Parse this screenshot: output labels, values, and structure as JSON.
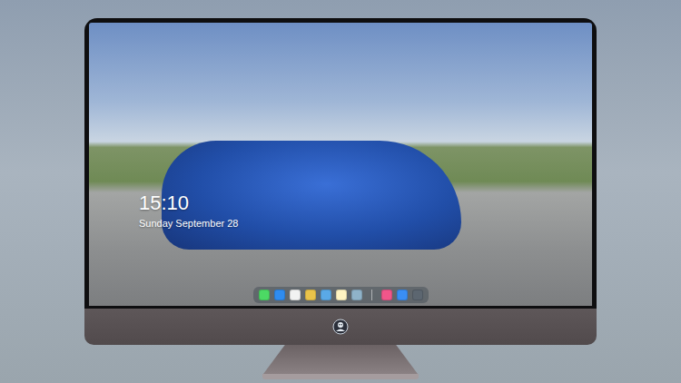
{
  "clock": {
    "time": "15:10",
    "date": "Sunday September 28"
  },
  "dock": {
    "items": [
      {
        "kind": "app",
        "color": "#4cd964"
      },
      {
        "kind": "app",
        "color": "#2f8cf0"
      },
      {
        "kind": "app",
        "color": "#f2f2f2"
      },
      {
        "kind": "app",
        "color": "#e9c34a"
      },
      {
        "kind": "app",
        "color": "#5aa9e6"
      },
      {
        "kind": "app",
        "color": "#fff4c2"
      },
      {
        "kind": "app",
        "color": "#8fb3c9"
      },
      {
        "kind": "separator",
        "color": "#ffffff"
      },
      {
        "kind": "app",
        "color": "#f0568a"
      },
      {
        "kind": "app",
        "color": "#3a8ef5"
      },
      {
        "kind": "app",
        "color": "#5c6670"
      }
    ]
  }
}
